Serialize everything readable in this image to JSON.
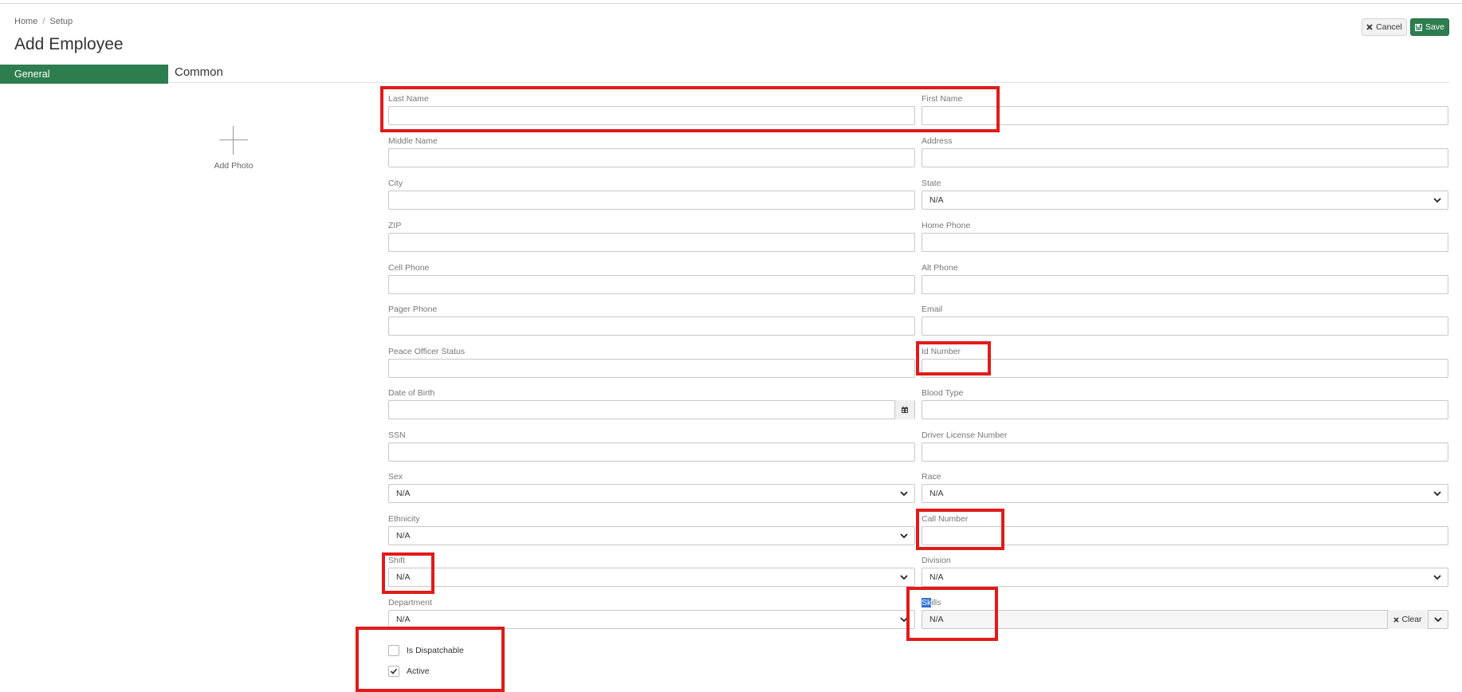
{
  "breadcrumb": {
    "home": "Home",
    "separator": "/",
    "current": "Setup"
  },
  "page_title": "Add Employee",
  "toolbar": {
    "cancel_label": "Cancel",
    "save_label": "Save"
  },
  "tabs": {
    "general": "General",
    "common": "Common"
  },
  "photo": {
    "label": "Add Photo"
  },
  "form": {
    "last_name": "Last Name",
    "first_name": "First Name",
    "middle_name": "Middle Name",
    "address": "Address",
    "city": "City",
    "state": {
      "label": "State",
      "value": "N/A"
    },
    "zip": "ZIP",
    "home_phone": "Home Phone",
    "cell_phone": "Cell Phone",
    "alt_phone": "Alt Phone",
    "pager_phone": "Pager Phone",
    "email": "Email",
    "peace_officer_status": "Peace Officer Status",
    "id_number": "Id Number",
    "date_of_birth": "Date of Birth",
    "blood_type": "Blood Type",
    "ssn": "SSN",
    "driver_license_number": "Driver License Number",
    "sex": {
      "label": "Sex",
      "value": "N/A"
    },
    "race": {
      "label": "Race",
      "value": "N/A"
    },
    "ethnicity": {
      "label": "Ethnicity",
      "value": "N/A"
    },
    "call_number": "Call Number",
    "shift": {
      "label": "Shift",
      "value": "N/A"
    },
    "division": {
      "label": "Division",
      "value": "N/A"
    },
    "department": {
      "label": "Department",
      "value": "N/A"
    },
    "skills": {
      "label_highlight": "Sk",
      "label_rest": "ills",
      "value": "N/A",
      "clear_label": "Clear"
    },
    "is_dispatchable": {
      "label": "Is Dispatchable",
      "checked": false
    },
    "active": {
      "label": "Active",
      "checked": true
    }
  },
  "colors": {
    "accent": "#2e7d4f",
    "annotation": "#e11b1b",
    "selection": "#2f6fd6"
  },
  "icons": {
    "cancel": "times-icon",
    "save": "floppy-disk-icon",
    "calendar": "calendar-icon",
    "chevron": "chevron-down-icon",
    "check": "check-icon"
  }
}
